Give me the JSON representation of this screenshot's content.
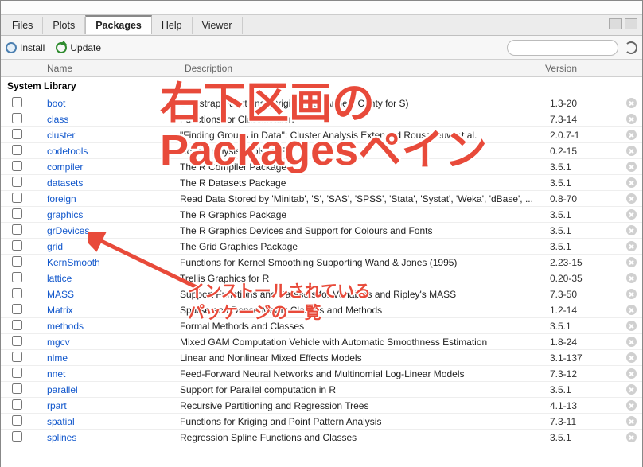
{
  "tabs": [
    "Files",
    "Plots",
    "Packages",
    "Help",
    "Viewer"
  ],
  "active_tab": 2,
  "toolbar": {
    "install_label": "Install",
    "update_label": "Update",
    "search_placeholder": ""
  },
  "columns": {
    "name": "Name",
    "desc": "Description",
    "ver": "Version"
  },
  "section_header": "System Library",
  "packages": [
    {
      "name": "boot",
      "desc": "Bootstrap Functions (Originally by Angelo Canty for S)",
      "ver": "1.3-20"
    },
    {
      "name": "class",
      "desc": "Functions for Classification",
      "ver": "7.3-14"
    },
    {
      "name": "cluster",
      "desc": "\"Finding Groups in Data\": Cluster Analysis Extended Rousseeuw et al.",
      "ver": "2.0.7-1"
    },
    {
      "name": "codetools",
      "desc": "Code Analysis Tools for R",
      "ver": "0.2-15"
    },
    {
      "name": "compiler",
      "desc": "The R Compiler Package",
      "ver": "3.5.1"
    },
    {
      "name": "datasets",
      "desc": "The R Datasets Package",
      "ver": "3.5.1"
    },
    {
      "name": "foreign",
      "desc": "Read Data Stored by 'Minitab', 'S', 'SAS', 'SPSS', 'Stata', 'Systat', 'Weka', 'dBase', ...",
      "ver": "0.8-70"
    },
    {
      "name": "graphics",
      "desc": "The R Graphics Package",
      "ver": "3.5.1"
    },
    {
      "name": "grDevices",
      "desc": "The R Graphics Devices and Support for Colours and Fonts",
      "ver": "3.5.1"
    },
    {
      "name": "grid",
      "desc": "The Grid Graphics Package",
      "ver": "3.5.1"
    },
    {
      "name": "KernSmooth",
      "desc": "Functions for Kernel Smoothing Supporting Wand & Jones (1995)",
      "ver": "2.23-15"
    },
    {
      "name": "lattice",
      "desc": "Trellis Graphics for R",
      "ver": "0.20-35"
    },
    {
      "name": "MASS",
      "desc": "Support Functions and Datasets for Venables and Ripley's MASS",
      "ver": "7.3-50"
    },
    {
      "name": "Matrix",
      "desc": "Sparse and Dense Matrix Classes and Methods",
      "ver": "1.2-14"
    },
    {
      "name": "methods",
      "desc": "Formal Methods and Classes",
      "ver": "3.5.1"
    },
    {
      "name": "mgcv",
      "desc": "Mixed GAM Computation Vehicle with Automatic Smoothness Estimation",
      "ver": "1.8-24"
    },
    {
      "name": "nlme",
      "desc": "Linear and Nonlinear Mixed Effects Models",
      "ver": "3.1-137"
    },
    {
      "name": "nnet",
      "desc": "Feed-Forward Neural Networks and Multinomial Log-Linear Models",
      "ver": "7.3-12"
    },
    {
      "name": "parallel",
      "desc": "Support for Parallel computation in R",
      "ver": "3.5.1"
    },
    {
      "name": "rpart",
      "desc": "Recursive Partitioning and Regression Trees",
      "ver": "4.1-13"
    },
    {
      "name": "spatial",
      "desc": "Functions for Kriging and Point Pattern Analysis",
      "ver": "7.3-11"
    },
    {
      "name": "splines",
      "desc": "Regression Spline Functions and Classes",
      "ver": "3.5.1"
    }
  ],
  "annotation": {
    "main_line1": "右下区画の",
    "main_line2": "Packagesペイン",
    "sub_line1": "インストールされている",
    "sub_line2": "パッケージの一覧"
  }
}
